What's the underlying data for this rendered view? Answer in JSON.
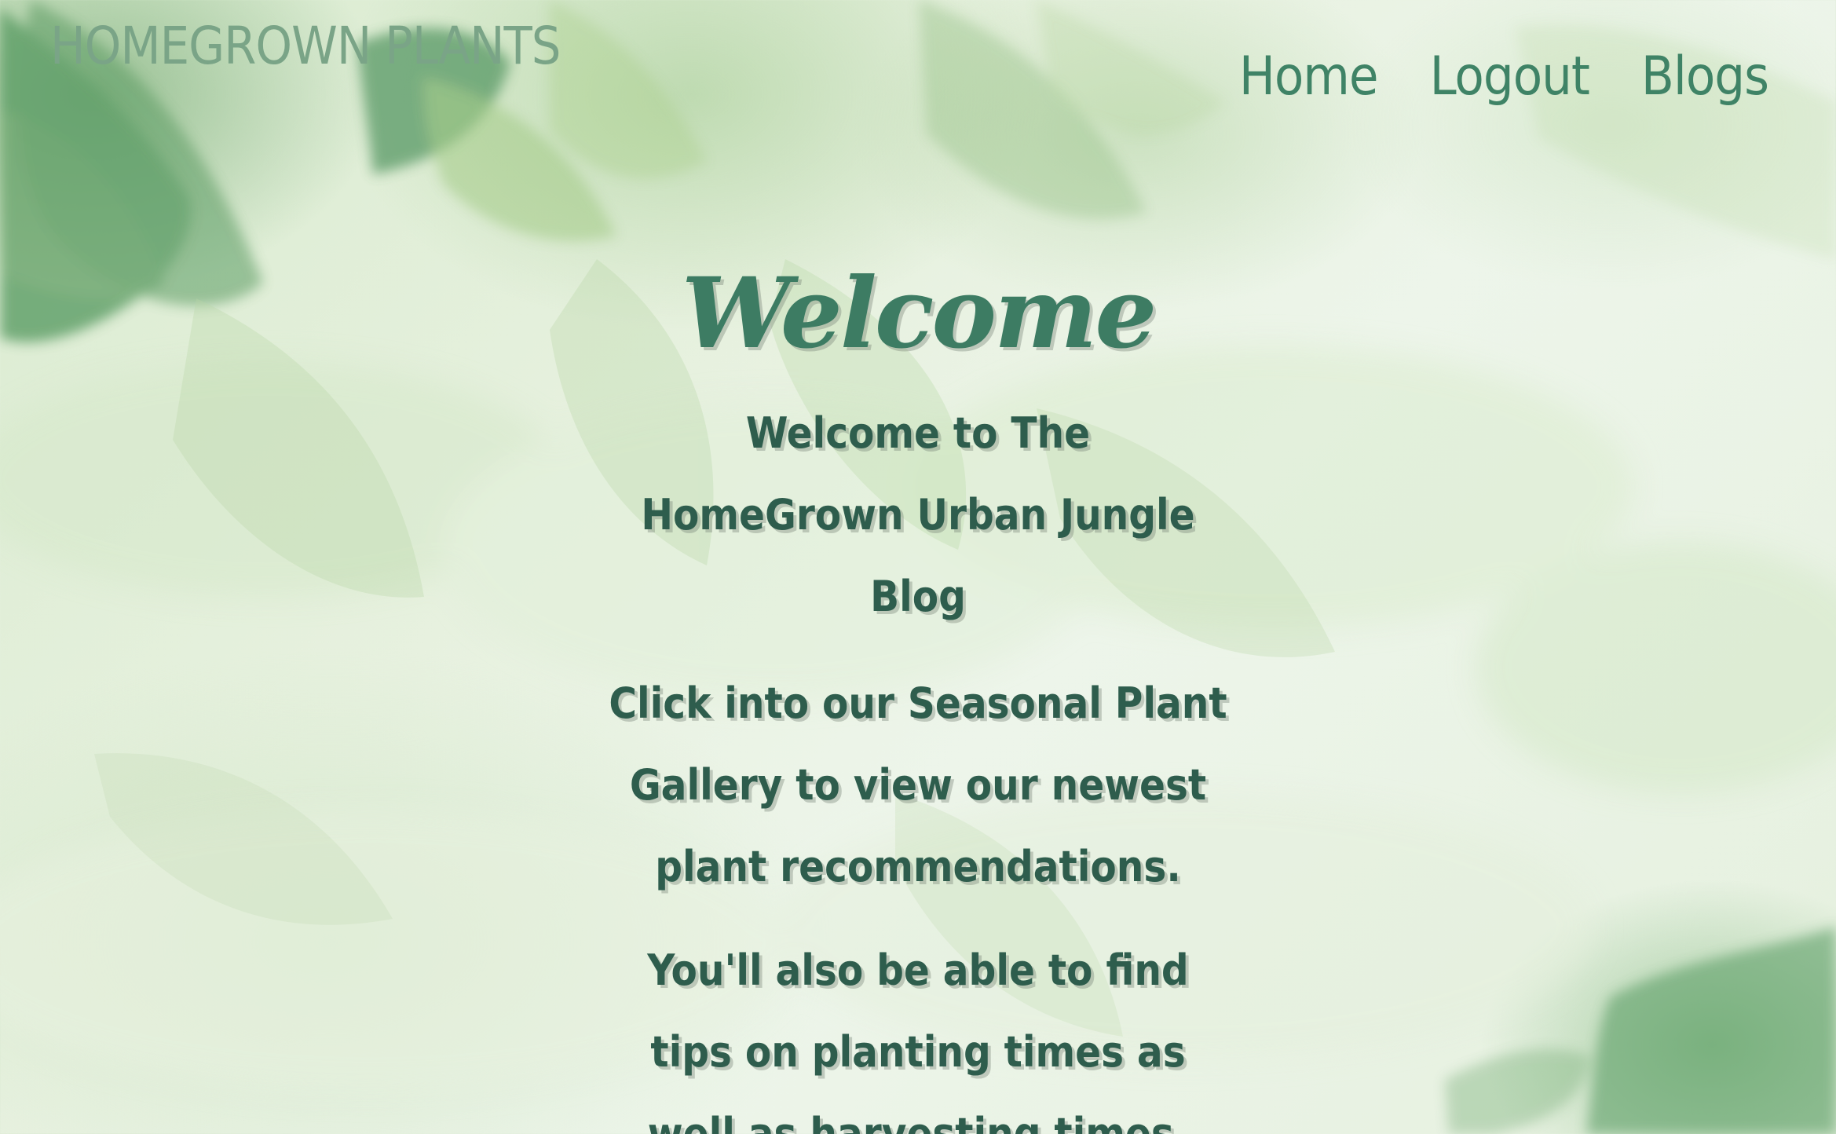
{
  "header": {
    "brand": "HOMEGROWN PLANTS",
    "nav": [
      {
        "label": "Home"
      },
      {
        "label": "Logout"
      },
      {
        "label": "Blogs"
      }
    ]
  },
  "hero": {
    "title": "Welcome",
    "paragraph_1": "Welcome to The HomeGrown Urban Jungle Blog",
    "paragraph_2": "Click into our Seasonal Plant Gallery to view our newest plant recommendations.",
    "paragraph_3": "You'll also be able to find tips on planting times as well as harvesting times."
  },
  "colors": {
    "brand": "#7aa487",
    "nav": "#3f8366",
    "title": "#3d7c63",
    "body_text": "#2e5d4d"
  },
  "icons": {
    "decorative_background": "watercolor-leaves"
  }
}
